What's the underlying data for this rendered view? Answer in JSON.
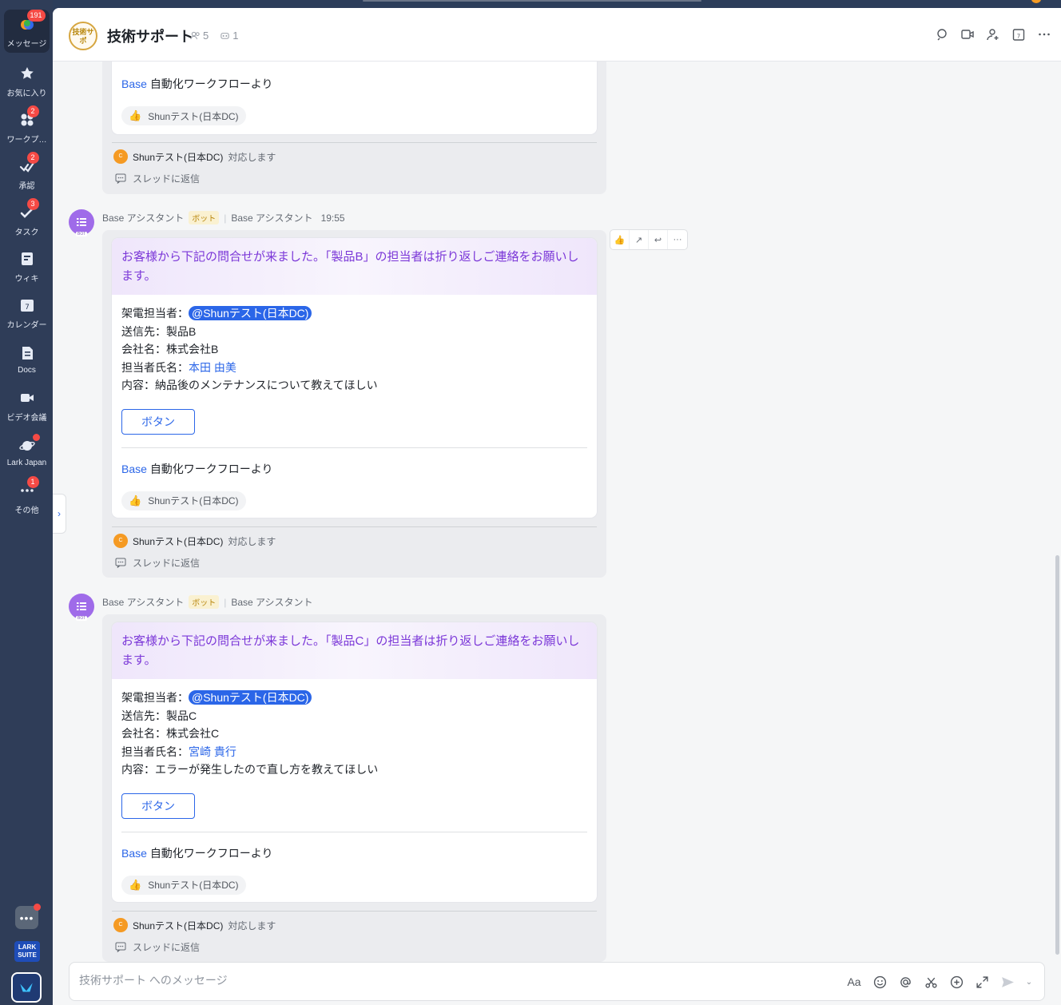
{
  "rail": {
    "items": [
      {
        "label": "メッセージ",
        "badge": "191",
        "icon": "chat-bubble-icon"
      },
      {
        "label": "お気に入り",
        "badge": "",
        "icon": "star-icon"
      },
      {
        "label": "ワークプ…",
        "badge": "2",
        "icon": "workplace-icon"
      },
      {
        "label": "承認",
        "badge": "2",
        "icon": "approval-icon"
      },
      {
        "label": "タスク",
        "badge": "3",
        "icon": "task-icon"
      },
      {
        "label": "ウィキ",
        "badge": "",
        "icon": "wiki-icon"
      },
      {
        "label": "カレンダー",
        "badge": "",
        "icon": "calendar-icon"
      },
      {
        "label": "Docs",
        "badge": "",
        "icon": "docs-icon"
      },
      {
        "label": "ビデオ会議",
        "badge": "",
        "icon": "video-icon"
      },
      {
        "label": "Lark Japan",
        "badge": "",
        "icon": "planet-icon"
      },
      {
        "label": "その他",
        "badge": "1",
        "icon": "more-icon"
      }
    ],
    "calendar_day": "7",
    "suite_label": "LARK SUITE"
  },
  "header": {
    "avatar_text": "技術サポ",
    "title": "技術サポート",
    "members": "5",
    "bots": "1"
  },
  "messages": [
    {
      "footer_link": "Base",
      "footer_text": "自動化ワークフローより",
      "reaction": "Shunテスト(日本DC)",
      "ack_name": "Shunテスト(日本DC)",
      "ack_text": "対応します",
      "thread": "スレッドに返信"
    },
    {
      "sender": "Base アシスタント",
      "bot_tag": "ボット",
      "via": "Base アシスタント",
      "time": "19:55",
      "headline": "お客様から下記の問合せが来ました。「製品B」の担当者は折り返しご連絡をお願いします。",
      "caller_label": "架電担当者：",
      "caller": "@Shunテスト(日本DC)",
      "dest": "送信先：製品B",
      "company": "会社名：株式会社B",
      "contact_label": "担当者氏名：",
      "contact": "本田 由美",
      "content": "内容：納品後のメンテナンスについて教えてほしい",
      "button": "ボタン",
      "footer_link": "Base",
      "footer_text": "自動化ワークフローより",
      "reaction": "Shunテスト(日本DC)",
      "ack_name": "Shunテスト(日本DC)",
      "ack_text": "対応します",
      "thread": "スレッドに返信"
    },
    {
      "sender": "Base アシスタント",
      "bot_tag": "ボット",
      "via": "Base アシスタント",
      "headline": "お客様から下記の問合せが来ました。「製品C」の担当者は折り返しご連絡をお願いします。",
      "caller_label": "架電担当者：",
      "caller": "@Shunテスト(日本DC)",
      "dest": "送信先：製品C",
      "company": "会社名：株式会社C",
      "contact_label": "担当者氏名：",
      "contact": "宮崎 貴行",
      "content": "内容：エラーが発生したので直し方を教えてほしい",
      "button": "ボタン",
      "footer_link": "Base",
      "footer_text": "自動化ワークフローより",
      "reaction": "Shunテスト(日本DC)",
      "ack_name": "Shunテスト(日本DC)",
      "ack_text": "対応します",
      "thread": "スレッドに返信"
    }
  ],
  "composer": {
    "placeholder": "技術サポート へのメッセージ",
    "font_label": "Aa"
  },
  "colors": {
    "accent": "#2b66e8",
    "headline": "#7b37d8",
    "rail": "#2f3d58",
    "badge": "#f54a45"
  }
}
